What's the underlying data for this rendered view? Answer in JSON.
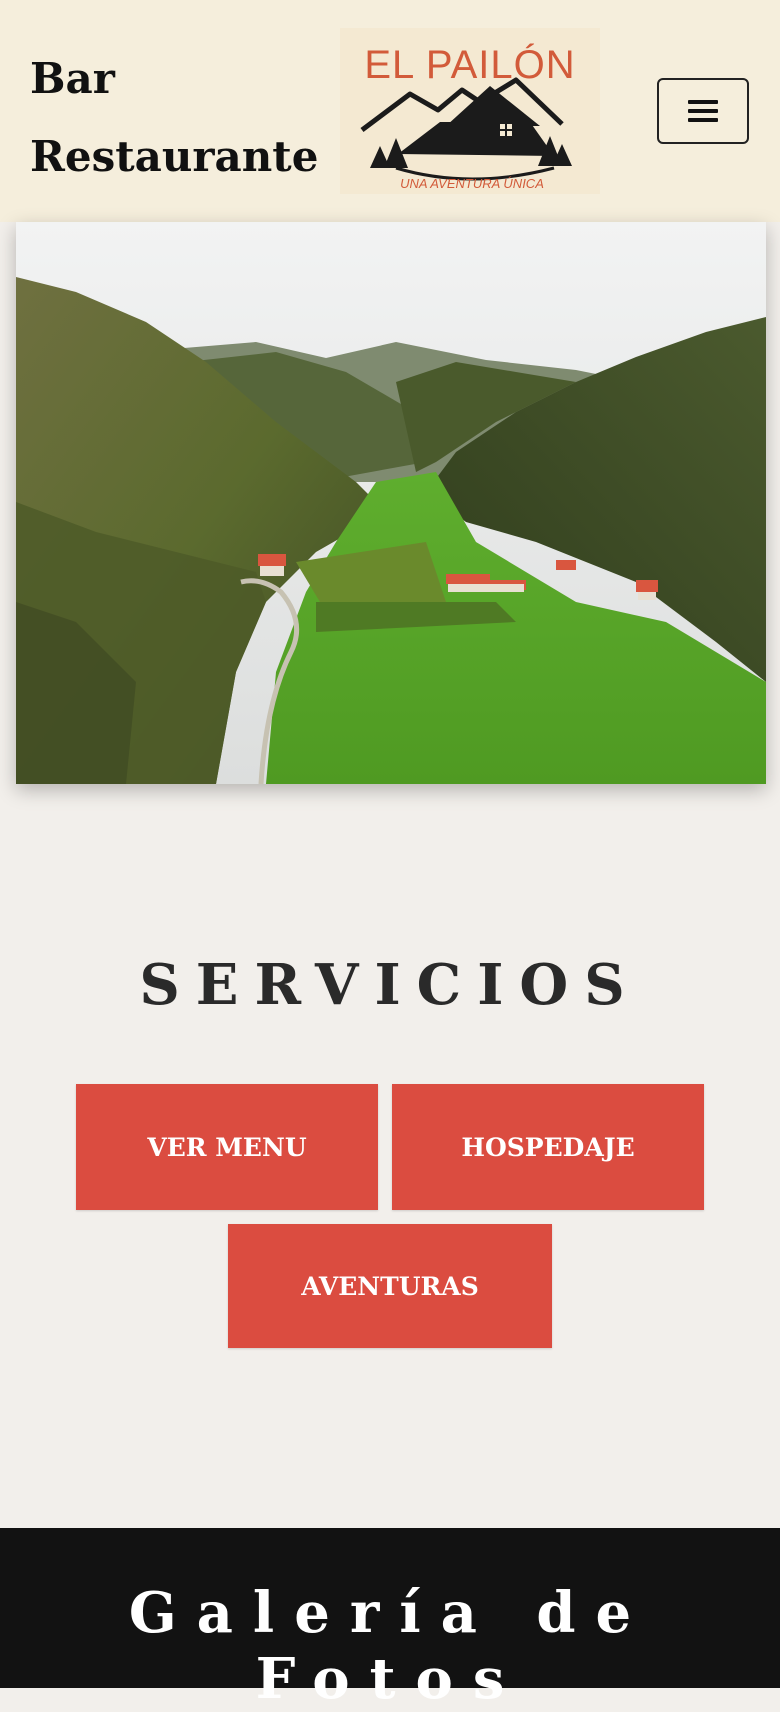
{
  "header": {
    "site_title": "Bar Restaurante",
    "logo": {
      "title": "EL PAILÓN",
      "tagline": "UNA AVENTURA ÚNICA",
      "icon": "mountain-house-icon"
    },
    "menu_icon": "hamburger-menu-icon"
  },
  "hero": {
    "image": "aerial-valley-photo"
  },
  "services": {
    "title": "SERVICIOS",
    "buttons": [
      "VER MENU",
      "HOSPEDAJE",
      "AVENTURAS"
    ]
  },
  "gallery": {
    "title": "Galería de Fotos"
  },
  "colors": {
    "header_bg": "#f5eedc",
    "page_bg": "#f2efeb",
    "accent": "#db4c40",
    "logo_red": "#d25b3a",
    "footer_bg": "#121212"
  }
}
